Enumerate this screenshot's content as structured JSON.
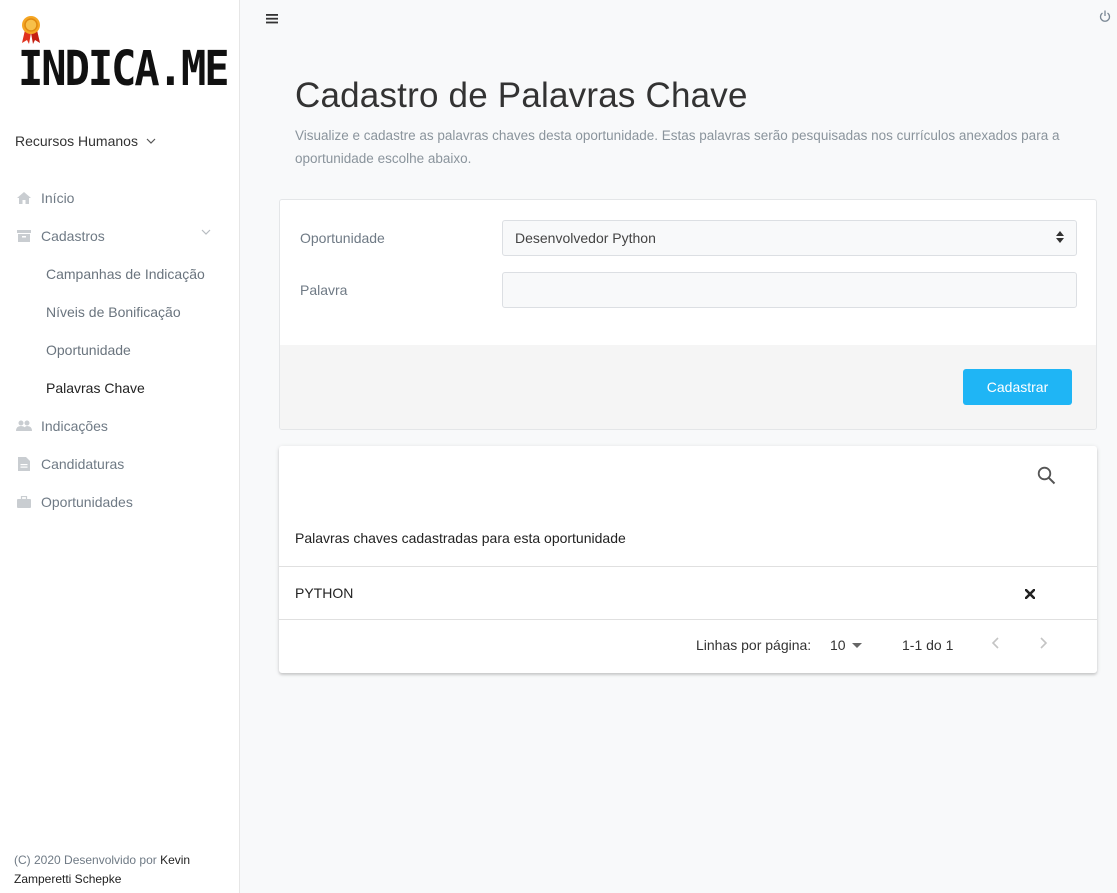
{
  "app": {
    "logo_text": "INDICA.ME",
    "department": "Recursos Humanos"
  },
  "sidebar": {
    "items": [
      {
        "label": "Início",
        "icon": "home-icon"
      },
      {
        "label": "Cadastros",
        "icon": "archive-icon",
        "expanded": true
      },
      {
        "label": "Campanhas de Indicação",
        "sub": true
      },
      {
        "label": "Níveis de Bonificação",
        "sub": true
      },
      {
        "label": "Oportunidade",
        "sub": true
      },
      {
        "label": "Palavras Chave",
        "sub": true,
        "active": true
      },
      {
        "label": "Indicações",
        "icon": "users-icon"
      },
      {
        "label": "Candidaturas",
        "icon": "file-icon"
      },
      {
        "label": "Oportunidades",
        "icon": "briefcase-icon"
      }
    ],
    "footer_prefix": "(C) 2020 Desenvolvido por ",
    "footer_author": "Kevin Zamperetti Schepke"
  },
  "page": {
    "title": "Cadastro de Palavras Chave",
    "description": "Visualize e cadastre as palavras chaves desta oportunidade. Estas palavras serão pesquisadas nos currículos anexados para a oportunidade escolhe abaixo."
  },
  "form": {
    "opportunity_label": "Oportunidade",
    "opportunity_value": "Desenvolvedor Python",
    "word_label": "Palavra",
    "word_value": "",
    "submit_label": "Cadastrar"
  },
  "table": {
    "caption": "Palavras chaves cadastradas para esta oportunidade",
    "rows": [
      {
        "word": "PYTHON"
      }
    ],
    "rows_per_page_label": "Linhas por página:",
    "rows_per_page": "10",
    "range": "1-1 do 1"
  },
  "colors": {
    "accent": "#1fb5f5",
    "background": "#f8f9fa"
  }
}
